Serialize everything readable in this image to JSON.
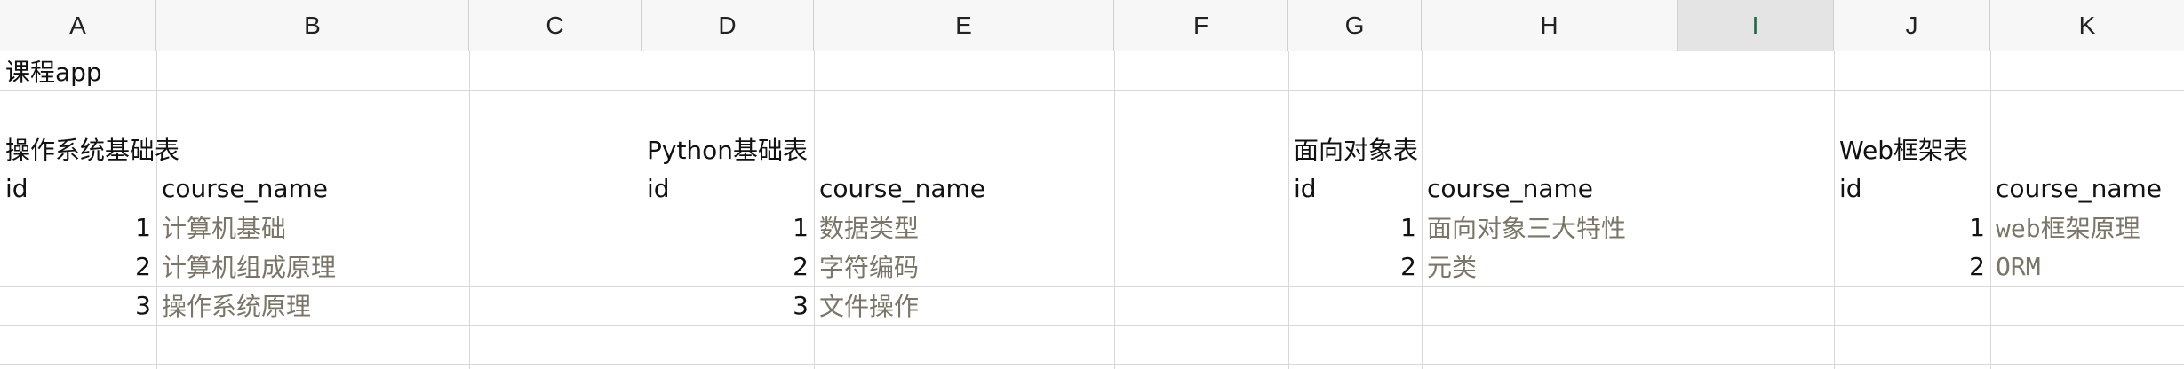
{
  "columns": [
    "A",
    "B",
    "C",
    "D",
    "E",
    "F",
    "G",
    "H",
    "I",
    "J",
    "K"
  ],
  "selected_column": "I",
  "title": "课程app",
  "tables": [
    {
      "name": "操作系统基础表",
      "headers": [
        "id",
        "course_name"
      ],
      "rows": [
        {
          "id": "1",
          "course_name": "计算机基础"
        },
        {
          "id": "2",
          "course_name": "计算机组成原理"
        },
        {
          "id": "3",
          "course_name": "操作系统原理"
        }
      ]
    },
    {
      "name": "Python基础表",
      "headers": [
        "id",
        "course_name"
      ],
      "rows": [
        {
          "id": "1",
          "course_name": "数据类型"
        },
        {
          "id": "2",
          "course_name": "字符编码"
        },
        {
          "id": "3",
          "course_name": "文件操作"
        }
      ]
    },
    {
      "name": "面向对象表",
      "headers": [
        "id",
        "course_name"
      ],
      "rows": [
        {
          "id": "1",
          "course_name": "面向对象三大特性"
        },
        {
          "id": "2",
          "course_name": "元类"
        }
      ]
    },
    {
      "name": "Web框架表",
      "headers": [
        "id",
        "course_name"
      ],
      "rows": [
        {
          "id": "1",
          "course_name": "web框架原理"
        },
        {
          "id": "2",
          "course_name": "ORM"
        }
      ]
    }
  ]
}
